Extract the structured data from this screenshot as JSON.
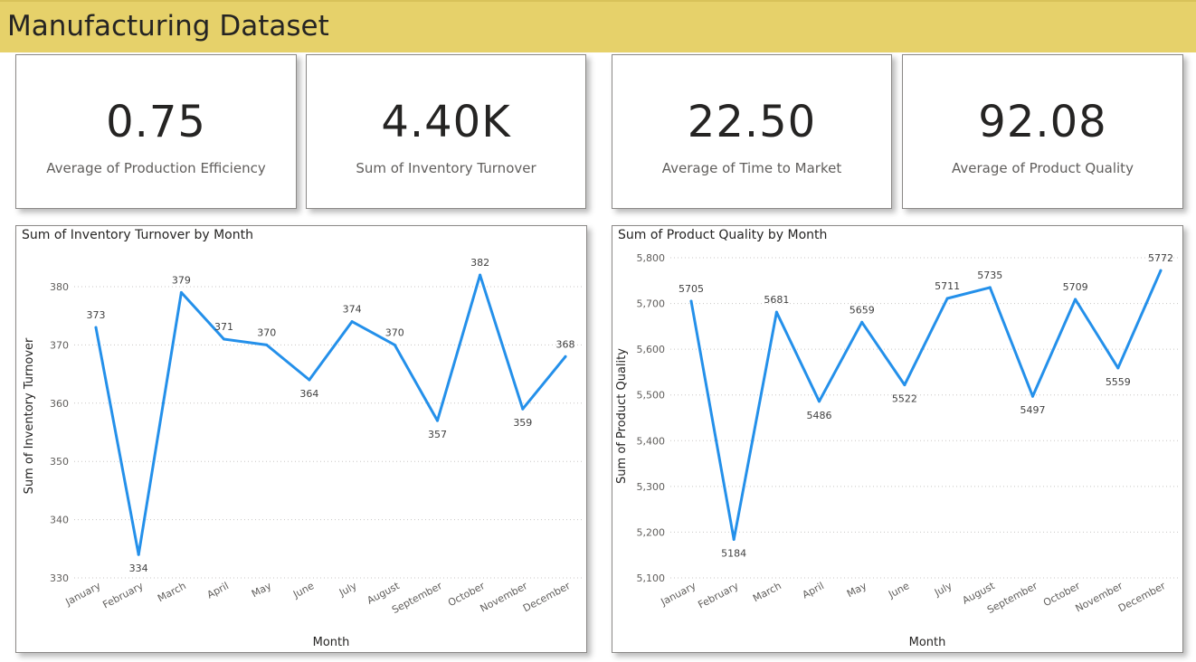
{
  "header": {
    "title": "Manufacturing Dataset"
  },
  "kpis": [
    {
      "value": "0.75",
      "label": "Average of Production Efficiency"
    },
    {
      "value": "4.40K",
      "label": "Sum of Inventory Turnover"
    },
    {
      "value": "22.50",
      "label": "Average of Time to Market"
    },
    {
      "value": "92.08",
      "label": "Average of Product Quality"
    }
  ],
  "charts": {
    "line_color": "#2490EA"
  },
  "chart_data": [
    {
      "type": "line",
      "title": "Sum of Inventory Turnover by Month",
      "xlabel": "Month",
      "ylabel": "Sum of Inventory Turnover",
      "categories": [
        "January",
        "February",
        "March",
        "April",
        "May",
        "June",
        "July",
        "August",
        "September",
        "October",
        "November",
        "December"
      ],
      "series": [
        {
          "values": [
            373,
            334,
            379,
            371,
            370,
            364,
            374,
            370,
            357,
            382,
            359,
            368
          ]
        }
      ],
      "data_labels": [
        "373",
        "334",
        "379",
        "371",
        "370",
        "364",
        "374",
        "370",
        "357",
        "382",
        "359",
        "368"
      ],
      "yticks": [
        "330",
        "340",
        "350",
        "360",
        "370",
        "380"
      ],
      "ylim": [
        330,
        385
      ],
      "grid": true
    },
    {
      "type": "line",
      "title": "Sum of Product Quality by Month",
      "xlabel": "Month",
      "ylabel": "Sum of Product Quality",
      "categories": [
        "January",
        "February",
        "March",
        "April",
        "May",
        "June",
        "July",
        "August",
        "September",
        "October",
        "November",
        "December"
      ],
      "series": [
        {
          "values": [
            5705,
            5184,
            5681,
            5486,
            5659,
            5522,
            5711,
            5735,
            5497,
            5709,
            5559,
            5772
          ]
        }
      ],
      "data_labels": [
        "5705",
        "5184",
        "5681",
        "5486",
        "5659",
        "5522",
        "5711",
        "5735",
        "5497",
        "5709",
        "5559",
        "5772"
      ],
      "yticks": [
        "5,100",
        "5,200",
        "5,300",
        "5,400",
        "5,500",
        "5,600",
        "5,700",
        "5,800"
      ],
      "ylim": [
        5100,
        5800
      ],
      "grid": true
    }
  ]
}
